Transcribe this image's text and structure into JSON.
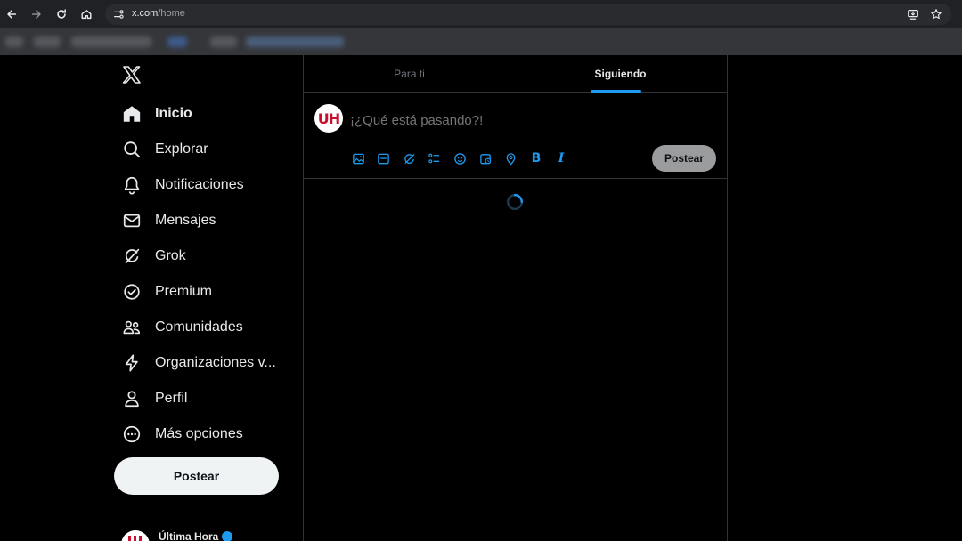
{
  "browser": {
    "url_host": "x.com",
    "url_path": "/home"
  },
  "sidebar": {
    "items": [
      {
        "label": "Inicio",
        "icon": "home-icon"
      },
      {
        "label": "Explorar",
        "icon": "search-icon"
      },
      {
        "label": "Notificaciones",
        "icon": "bell-icon"
      },
      {
        "label": "Mensajes",
        "icon": "mail-icon"
      },
      {
        "label": "Grok",
        "icon": "grok-icon"
      },
      {
        "label": "Premium",
        "icon": "premium-icon"
      },
      {
        "label": "Comunidades",
        "icon": "communities-icon"
      },
      {
        "label": "Organizaciones v...",
        "icon": "lightning-icon"
      },
      {
        "label": "Perfil",
        "icon": "person-icon"
      },
      {
        "label": "Más opciones",
        "icon": "more-circle-icon"
      }
    ],
    "post_button": "Postear",
    "account_name": "Última Hora"
  },
  "main": {
    "tabs": [
      {
        "label": "Para ti"
      },
      {
        "label": "Siguiendo"
      }
    ],
    "composer": {
      "avatar_text": "UH",
      "placeholder": "¡¿Qué está pasando?!",
      "post_button": "Postear",
      "bold_tool": "B",
      "italic_tool": "I"
    }
  },
  "colors": {
    "accent": "#1d9bf0",
    "background": "#000000",
    "border": "#2f3336",
    "brand_red": "#c8102e"
  }
}
